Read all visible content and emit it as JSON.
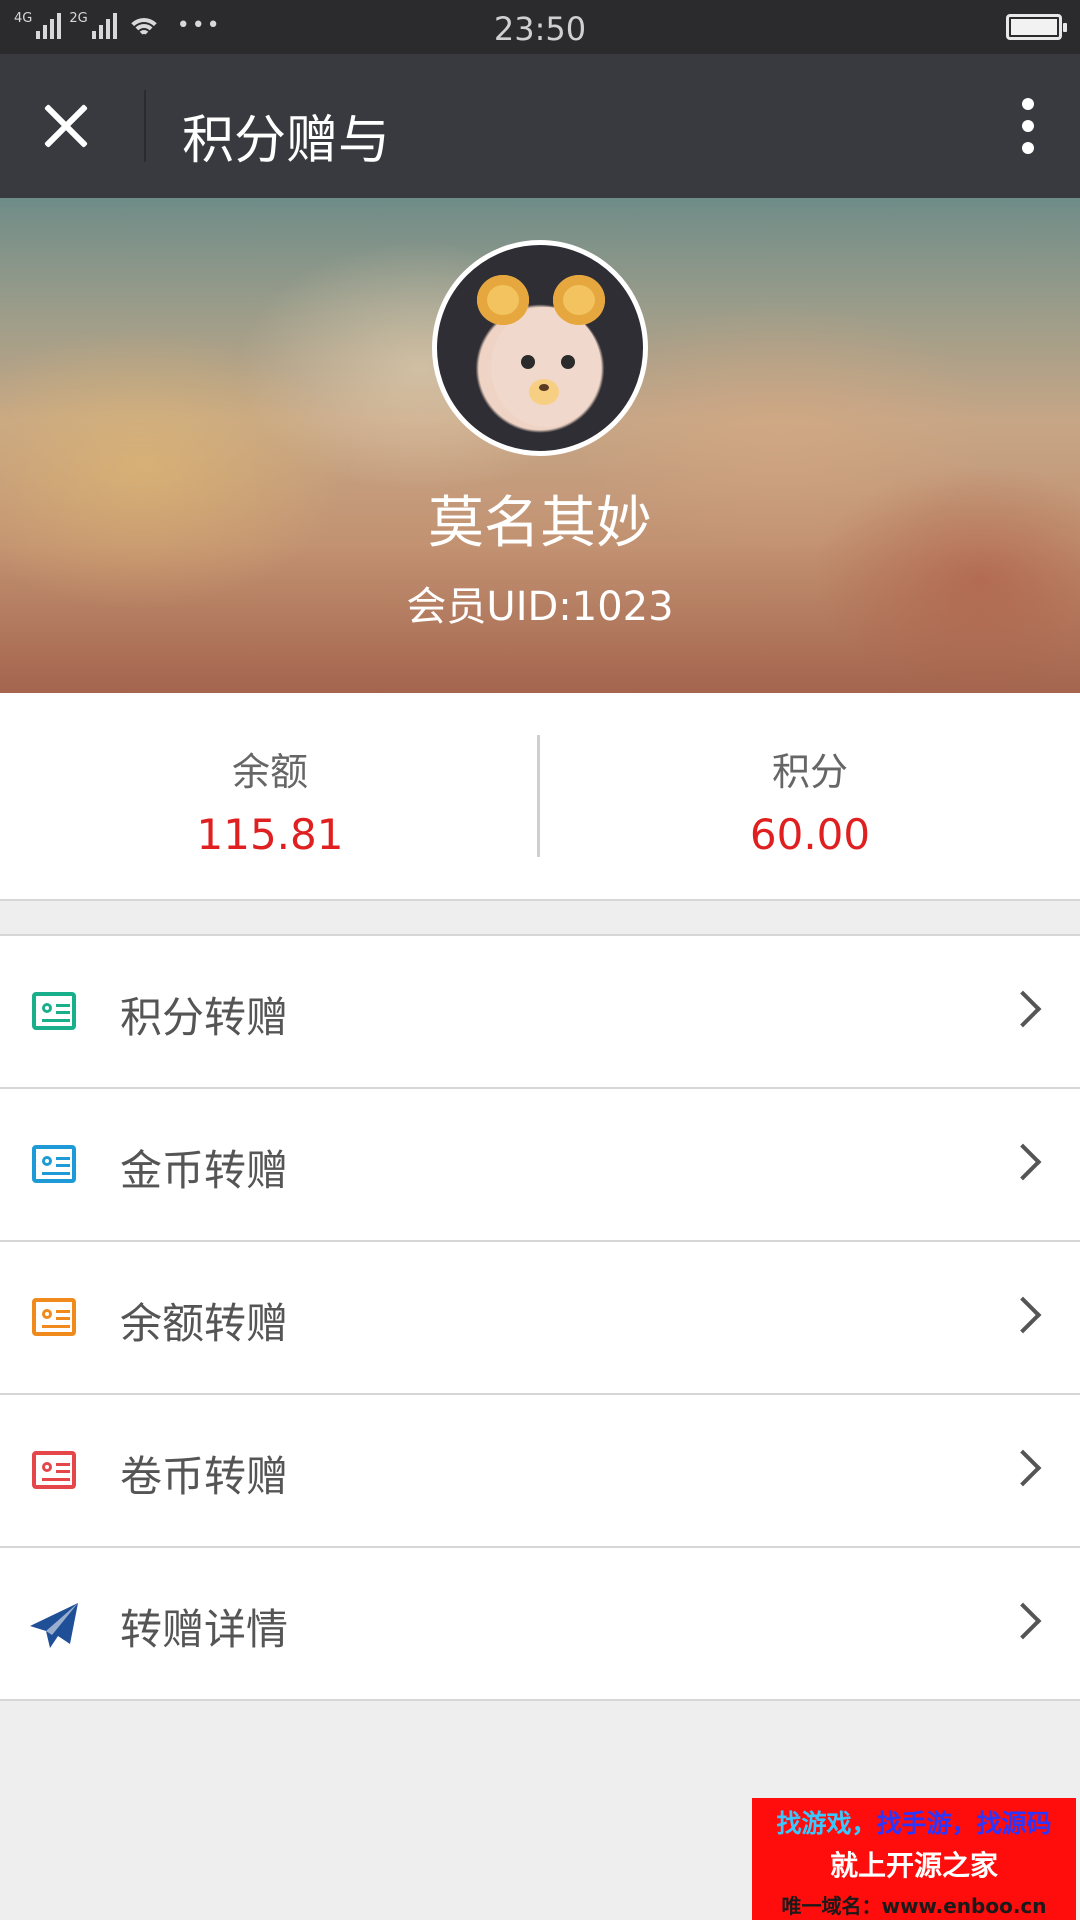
{
  "status_bar": {
    "network_1": "4G",
    "network_2": "2G",
    "more": "•••",
    "time": "23:50",
    "icons": [
      "signal-icon",
      "wifi-icon",
      "battery-icon"
    ]
  },
  "header": {
    "title": "积分赠与",
    "close_icon": "close-icon",
    "more_icon": "more-vertical-icon"
  },
  "profile": {
    "name": "莫名其妙",
    "uid_label": "会员UID:1023"
  },
  "stats": {
    "balance_label": "余额",
    "balance_value": "115.81",
    "points_label": "积分",
    "points_value": "60.00"
  },
  "menu": {
    "items": [
      {
        "label": "积分转赠",
        "icon": "id-card-icon",
        "color": "#1aaf8b"
      },
      {
        "label": "金币转赠",
        "icon": "id-card-icon",
        "color": "#1e9bd7"
      },
      {
        "label": "余额转赠",
        "icon": "id-card-icon",
        "color": "#f08a1c"
      },
      {
        "label": "卷币转赠",
        "icon": "id-card-icon",
        "color": "#e5464a"
      },
      {
        "label": "转赠详情",
        "icon": "paper-plane-icon",
        "color": "#1f4f96"
      }
    ]
  },
  "watermark": {
    "line1_a": "找游戏，",
    "line1_b": "找手游，找源码",
    "line2": "就上开源之家",
    "line3": "唯一域名：www.enboo.cn"
  },
  "colors": {
    "header_bg": "#393a3f",
    "status_bg": "#2b2b2e",
    "value_red": "#e02020",
    "page_bg": "#eeeeee"
  }
}
